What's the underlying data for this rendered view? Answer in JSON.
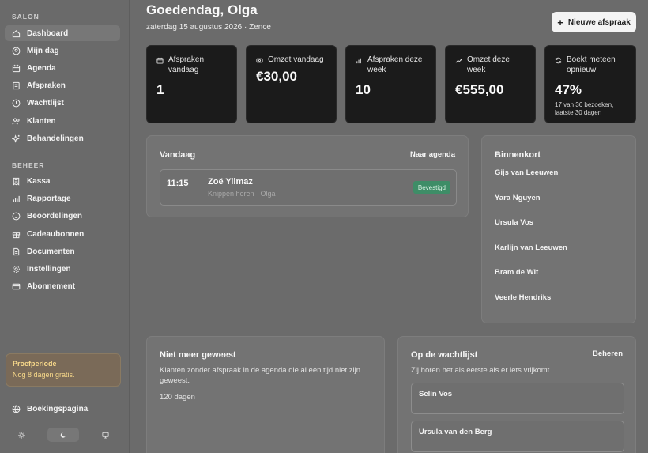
{
  "sidebar": {
    "section1": "SALON",
    "section2": "BEHEER",
    "items1": [
      {
        "label": "Dashboard",
        "icon": "home-icon"
      },
      {
        "label": "Mijn dag",
        "icon": "user-circle-icon"
      },
      {
        "label": "Agenda",
        "icon": "calendar-icon"
      },
      {
        "label": "Afspraken",
        "icon": "list-icon"
      },
      {
        "label": "Wachtlijst",
        "icon": "clock-icon"
      },
      {
        "label": "Klanten",
        "icon": "users-icon"
      },
      {
        "label": "Behandelingen",
        "icon": "sparkles-icon"
      }
    ],
    "items2": [
      {
        "label": "Kassa",
        "icon": "receipt-icon"
      },
      {
        "label": "Rapportage",
        "icon": "bar-chart-icon"
      },
      {
        "label": "Beoordelingen",
        "icon": "smile-icon"
      },
      {
        "label": "Cadeaubonnen",
        "icon": "gift-icon"
      },
      {
        "label": "Documenten",
        "icon": "document-icon"
      },
      {
        "label": "Instellingen",
        "icon": "gear-icon"
      },
      {
        "label": "Abonnement",
        "icon": "credit-card-icon"
      }
    ],
    "trial": {
      "title": "Proefperiode",
      "text": "Nog 8 dagen gratis."
    },
    "booking_page": "Boekingspagina"
  },
  "header": {
    "greeting": "Goedendag, Olga",
    "date_line": "zaterdag 15 augustus 2026 · Zence",
    "new_button": "Nieuwe afspraak"
  },
  "stats": [
    {
      "label": "Afspraken vandaag",
      "value": "1",
      "icon": "calendar-icon"
    },
    {
      "label": "Omzet vandaag",
      "value": "€30,00",
      "icon": "cash-icon"
    },
    {
      "label": "Afspraken deze week",
      "value": "10",
      "icon": "bar-chart-icon"
    },
    {
      "label": "Omzet deze week",
      "value": "€555,00",
      "icon": "trend-up-icon"
    },
    {
      "label": "Boekt meteen opnieuw",
      "value": "47%",
      "note": "17 van 36 bezoeken, laatste 30 dagen",
      "icon": "refresh-icon"
    }
  ],
  "today": {
    "title": "Vandaag",
    "link": "Naar agenda",
    "appointment": {
      "time": "11:15",
      "name": "Zoë Yilmaz",
      "detail": "Knippen heren · Olga",
      "status": "Bevestigd"
    }
  },
  "soon": {
    "title": "Binnenkort",
    "items": [
      "Gijs van Leeuwen",
      "Yara Nguyen",
      "Ursula Vos",
      "Karlijn van Leeuwen",
      "Bram de Wit",
      "Veerle Hendriks"
    ]
  },
  "not_seen": {
    "title": "Niet meer geweest",
    "description": "Klanten zonder afspraak in de agenda die al een tijd niet zijn geweest.",
    "days": "120 dagen"
  },
  "waitlist": {
    "title": "Op de wachtlijst",
    "link": "Beheren",
    "description": "Zij horen het als eerste als er iets vrijkomt.",
    "items": [
      "Selin Vos",
      "Ursula van den Berg"
    ]
  },
  "colors": {
    "badge_green": "#3e8d67",
    "stat_bg": "#1b1b1b",
    "trial_text": "#f7d88a"
  }
}
